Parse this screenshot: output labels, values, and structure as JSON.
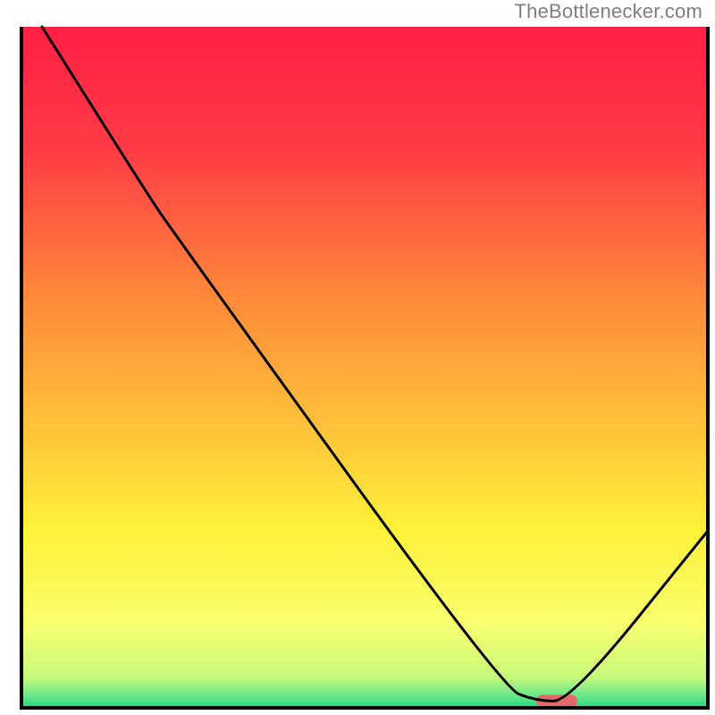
{
  "watermark": {
    "text": "TheBottlenecker.com"
  },
  "chart_data": {
    "type": "line",
    "title": "",
    "xlabel": "",
    "ylabel": "",
    "xlim": [
      0,
      100
    ],
    "ylim": [
      0,
      100
    ],
    "grid": false,
    "legend": false,
    "series": [
      {
        "name": "black-curve",
        "points": [
          {
            "x": 3,
            "y": 100
          },
          {
            "x": 18,
            "y": 76
          },
          {
            "x": 22,
            "y": 70
          },
          {
            "x": 70,
            "y": 3
          },
          {
            "x": 75,
            "y": 1
          },
          {
            "x": 80,
            "y": 1
          },
          {
            "x": 100,
            "y": 26
          }
        ]
      }
    ],
    "marker": {
      "name": "highlight-segment",
      "x0": 75,
      "x1": 81,
      "y": 1,
      "color": "#e46a6a"
    },
    "background_gradient": {
      "stops": [
        {
          "pos": 0.0,
          "color": "#ff1f44"
        },
        {
          "pos": 0.18,
          "color": "#ff3b46"
        },
        {
          "pos": 0.4,
          "color": "#ff8a3a"
        },
        {
          "pos": 0.58,
          "color": "#ffc03a"
        },
        {
          "pos": 0.74,
          "color": "#fff23a"
        },
        {
          "pos": 0.88,
          "color": "#f7ff70"
        },
        {
          "pos": 0.955,
          "color": "#c8f97a"
        },
        {
          "pos": 0.985,
          "color": "#5fe68a"
        },
        {
          "pos": 1.0,
          "color": "#22d57a"
        }
      ]
    },
    "frame_color": "#000000"
  }
}
